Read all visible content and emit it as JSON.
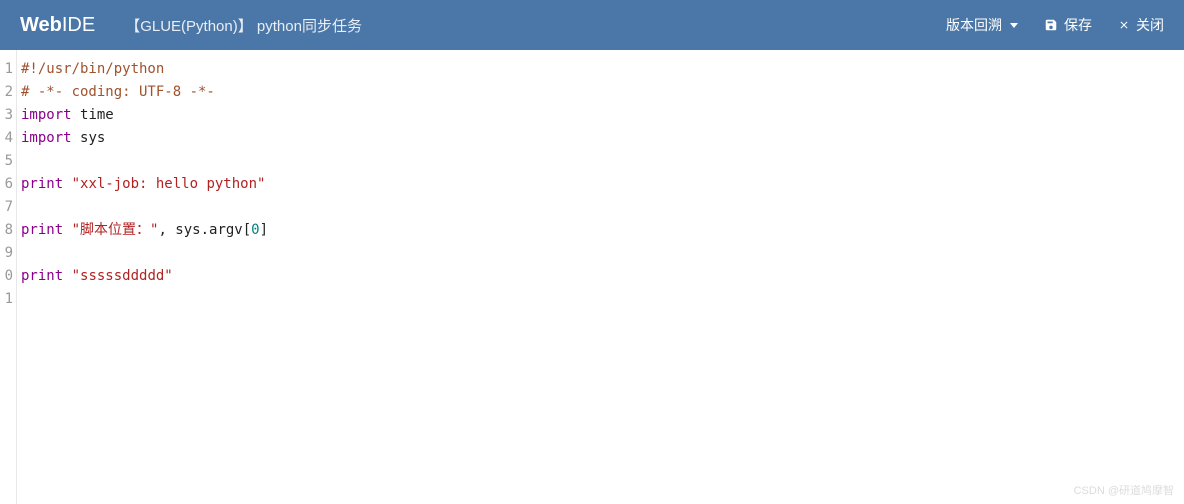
{
  "header": {
    "logo_pre": "Web",
    "logo_post": "IDE",
    "title": "【GLUE(Python)】 python同步任务",
    "version_btn": "版本回溯",
    "save_btn": "保存",
    "close_btn": "关闭"
  },
  "editor": {
    "line_numbers": [
      "1",
      "2",
      "3",
      "4",
      "5",
      "6",
      "7",
      "8",
      "9",
      "0",
      "1"
    ],
    "lines": [
      [
        {
          "cls": "c-comment",
          "t": "#!/usr/bin/python"
        }
      ],
      [
        {
          "cls": "c-comment",
          "t": "# -*- coding: UTF-8 -*-"
        }
      ],
      [
        {
          "cls": "c-keyword",
          "t": "import"
        },
        {
          "cls": "c-punct",
          "t": " "
        },
        {
          "cls": "c-ident",
          "t": "time"
        }
      ],
      [
        {
          "cls": "c-keyword",
          "t": "import"
        },
        {
          "cls": "c-punct",
          "t": " "
        },
        {
          "cls": "c-ident",
          "t": "sys"
        }
      ],
      [],
      [
        {
          "cls": "c-keyword",
          "t": "print"
        },
        {
          "cls": "c-punct",
          "t": " "
        },
        {
          "cls": "c-string",
          "t": "\"xxl-job: hello python\""
        }
      ],
      [],
      [
        {
          "cls": "c-keyword",
          "t": "print"
        },
        {
          "cls": "c-punct",
          "t": " "
        },
        {
          "cls": "c-string",
          "t": "\"脚本位置：\""
        },
        {
          "cls": "c-punct",
          "t": ", sys.argv["
        },
        {
          "cls": "c-number",
          "t": "0"
        },
        {
          "cls": "c-punct",
          "t": "]"
        }
      ],
      [],
      [
        {
          "cls": "c-keyword",
          "t": "print"
        },
        {
          "cls": "c-punct",
          "t": " "
        },
        {
          "cls": "c-string",
          "t": "\"sssssddddd\""
        }
      ],
      []
    ]
  },
  "watermark": "CSDN @研道鸠摩智"
}
